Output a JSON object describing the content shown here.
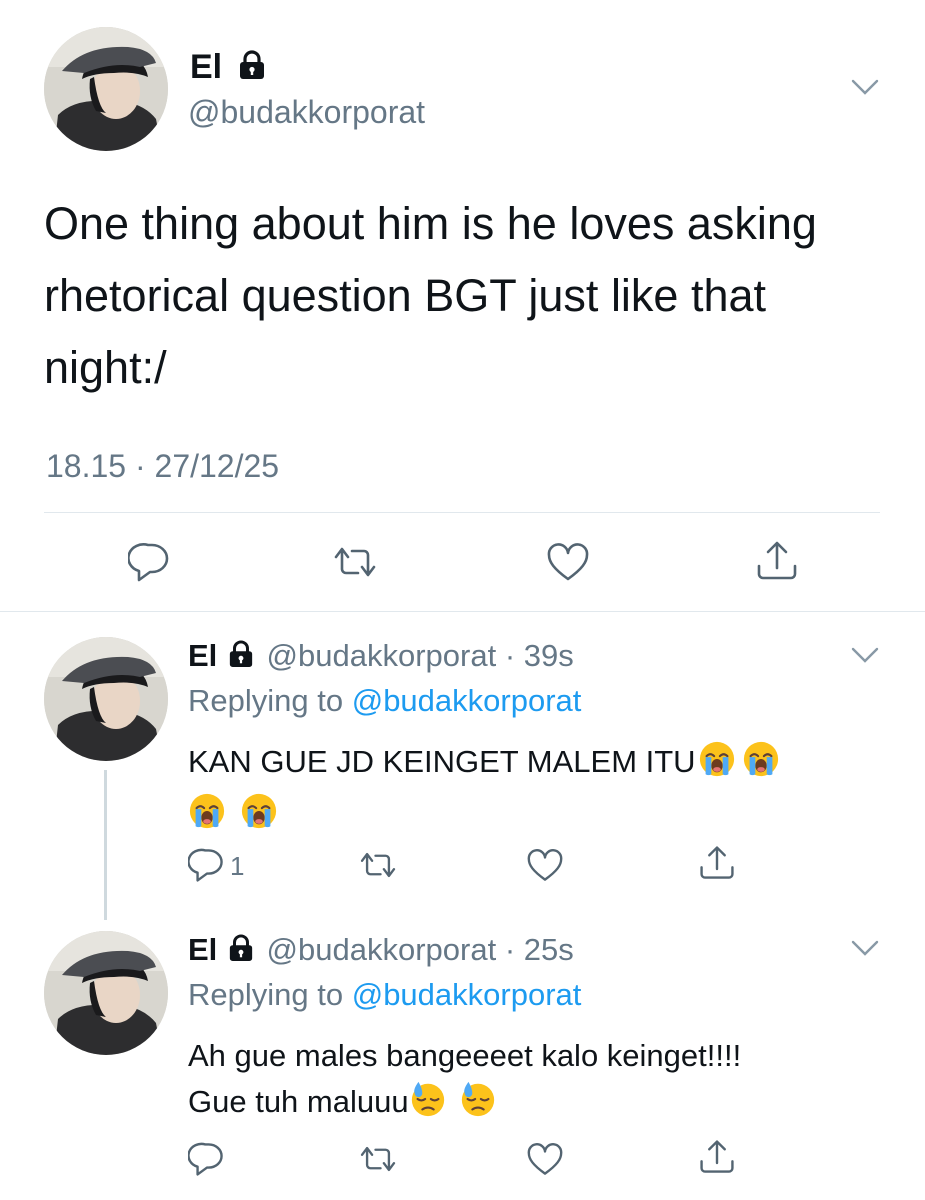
{
  "main_tweet": {
    "display_name": "El",
    "handle": "@budakkorporat",
    "text": "One thing about him is he loves asking rhetorical question BGT just like that night:/",
    "timestamp": "18.15 · 27/12/25"
  },
  "replies": [
    {
      "display_name": "El",
      "handle_time": "@budakkorporat · 39s",
      "replying_prefix": "Replying to ",
      "replying_handle": "@budakkorporat",
      "text": "KAN GUE JD KEINGET MALEM ITU",
      "emojis": [
        "loudly-crying-face",
        "loudly-crying-face",
        "loudly-crying-face",
        "loudly-crying-face"
      ],
      "reply_count": "1"
    },
    {
      "display_name": "El",
      "handle_time": "@budakkorporat · 25s",
      "replying_prefix": "Replying to ",
      "replying_handle": "@budakkorporat",
      "text_line1": "Ah gue males bangeeeet kalo keinget!!!!",
      "text_line2": "Gue tuh maluuu",
      "emojis": [
        "downcast-face-with-sweat",
        "downcast-face-with-sweat"
      ]
    }
  ],
  "colors": {
    "text": "#0f1419",
    "secondary": "#657786",
    "link": "#1d9bf0",
    "divider": "#e1e8ed",
    "icon": "#536471"
  },
  "icons": [
    "lock-icon",
    "chevron-down-icon",
    "reply-icon",
    "retweet-icon",
    "like-icon",
    "share-icon"
  ]
}
